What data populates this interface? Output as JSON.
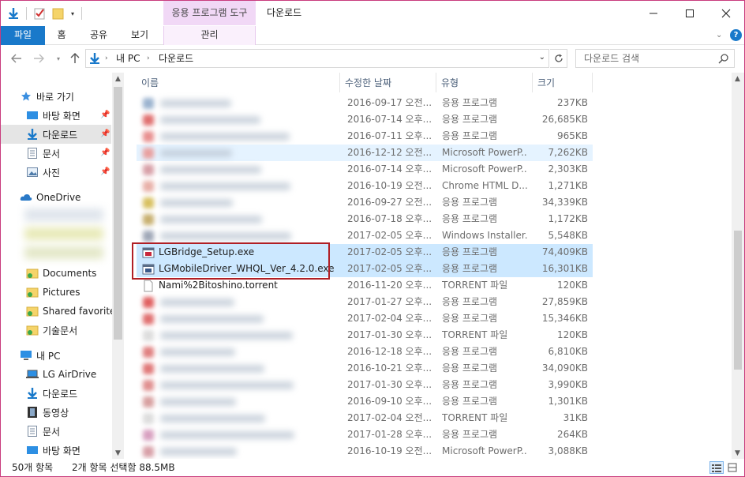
{
  "titlebar": {
    "context_tab": "응용 프로그램 도구",
    "title": "다운로드",
    "minimize": "—",
    "maximize": "☐",
    "close": "✕"
  },
  "ribbon": {
    "tabs": [
      "파일",
      "홈",
      "공유",
      "보기"
    ],
    "context_subtab": "관리"
  },
  "address": {
    "crumbs": [
      "내 PC",
      "다운로드"
    ],
    "search_placeholder": "다운로드 검색"
  },
  "nav": {
    "quick_access": "바로 가기",
    "quick_items": [
      "바탕 화면",
      "다운로드",
      "문서",
      "사진"
    ],
    "onedrive": "OneDrive",
    "onedrive_items": [
      "Documents",
      "Pictures",
      "Shared favorites",
      "기술문서"
    ],
    "this_pc": "내 PC",
    "pc_items": [
      "LG AirDrive",
      "다운로드",
      "동영상",
      "문서",
      "바탕 화면"
    ]
  },
  "columns": {
    "name": "이름",
    "date": "수정한 날짜",
    "type": "유형",
    "size": "크기"
  },
  "files": [
    {
      "name": "",
      "date": "2016-09-17 오전...",
      "type": "응용 프로그램",
      "size": "237KB",
      "color": "#9bb3cf"
    },
    {
      "name": "",
      "date": "2016-07-14 오후...",
      "type": "응용 프로그램",
      "size": "26,685KB",
      "color": "#e07070"
    },
    {
      "name": "",
      "date": "2016-07-11 오후...",
      "type": "응용 프로그램",
      "size": "965KB",
      "color": "#e89090"
    },
    {
      "name": "",
      "date": "2016-12-12 오전...",
      "type": "Microsoft PowerP...",
      "size": "7,262KB",
      "color": "#e8a0a0"
    },
    {
      "name": "",
      "date": "2016-07-14 오후...",
      "type": "Microsoft PowerP...",
      "size": "2,303KB",
      "color": "#d8a0a8"
    },
    {
      "name": "",
      "date": "2016-10-19 오전...",
      "type": "Chrome HTML D...",
      "size": "1,271KB",
      "color": "#e8b0a8"
    },
    {
      "name": "",
      "date": "2016-09-27 오전...",
      "type": "응용 프로그램",
      "size": "34,339KB",
      "color": "#d8c060"
    },
    {
      "name": "",
      "date": "2016-07-18 오후...",
      "type": "응용 프로그램",
      "size": "1,172KB",
      "color": "#c8b070"
    },
    {
      "name": "",
      "date": "2017-02-05 오후...",
      "type": "Windows Installer...",
      "size": "5,548KB",
      "color": "#a0a8b8"
    },
    {
      "name": "LGBridge_Setup.exe",
      "date": "2017-02-05 오후...",
      "type": "응용 프로그램",
      "size": "74,409KB",
      "color": "#c8283c"
    },
    {
      "name": "LGMobileDriver_WHQL_Ver_4.2.0.exe",
      "date": "2017-02-05 오후...",
      "type": "응용 프로그램",
      "size": "16,301KB",
      "color": "#3a5a8a"
    },
    {
      "name": "Nami%2Bitoshino.torrent",
      "date": "2016-11-20 오후...",
      "type": "TORRENT 파일",
      "size": "120KB",
      "color": "#ffffff"
    },
    {
      "name": "",
      "date": "2017-01-27 오후...",
      "type": "응용 프로그램",
      "size": "27,859KB",
      "color": "#e06060"
    },
    {
      "name": "",
      "date": "2017-02-04 오후...",
      "type": "응용 프로그램",
      "size": "15,346KB",
      "color": "#e07070"
    },
    {
      "name": "",
      "date": "2017-01-30 오후...",
      "type": "TORRENT 파일",
      "size": "120KB",
      "color": "#dddddd"
    },
    {
      "name": "",
      "date": "2016-12-18 오후...",
      "type": "응용 프로그램",
      "size": "6,810KB",
      "color": "#e08080"
    },
    {
      "name": "",
      "date": "2016-10-21 오후...",
      "type": "응용 프로그램",
      "size": "34,090KB",
      "color": "#e07878"
    },
    {
      "name": "",
      "date": "2017-01-30 오후...",
      "type": "응용 프로그램",
      "size": "3,990KB",
      "color": "#e09090"
    },
    {
      "name": "",
      "date": "2016-09-10 오후...",
      "type": "응용 프로그램",
      "size": "1,301KB",
      "color": "#d8a0a0"
    },
    {
      "name": "",
      "date": "2017-02-04 오전...",
      "type": "TORRENT 파일",
      "size": "31KB",
      "color": "#dddddd"
    },
    {
      "name": "",
      "date": "2017-01-28 오후...",
      "type": "응용 프로그램",
      "size": "264KB",
      "color": "#d8a0c0"
    },
    {
      "name": "",
      "date": "2016-10-19 오전...",
      "type": "Microsoft PowerP...",
      "size": "3,088KB",
      "color": "#d8a0a8"
    }
  ],
  "status": {
    "count": "50개 항목",
    "selection": "2개 항목 선택함 88.5MB"
  },
  "colors": {
    "accent": "#1979ca",
    "selection": "#cce8ff",
    "highlight_box": "#b01f25",
    "context_tab": "#f1d8f6"
  }
}
